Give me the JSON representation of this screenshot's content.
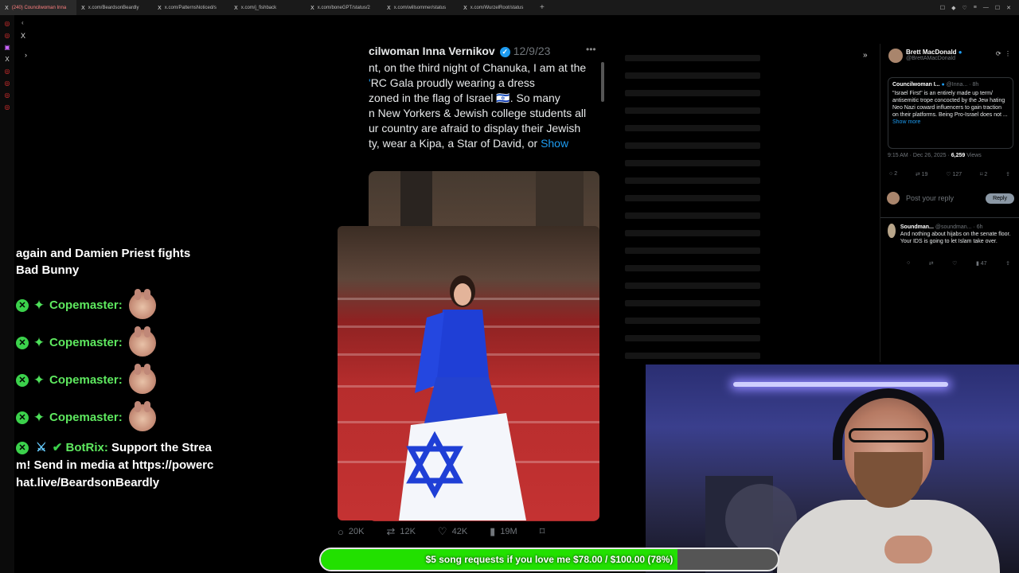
{
  "browser": {
    "tabs": [
      {
        "title": "(240) Councilwoman Inna",
        "active": true
      },
      {
        "title": "x.com/BeardsonBeardly"
      },
      {
        "title": "x.com/PatternsNoticed/s"
      },
      {
        "title": "x.com/j_fishback"
      },
      {
        "title": "x.com/boneGPT/status/2"
      },
      {
        "title": "x.com/willsommer/status"
      },
      {
        "title": "x.com/WurzelRoot/status"
      }
    ],
    "new_tab_label": "+"
  },
  "chat": {
    "lead_text": "again and Damien Priest fights Bad Bunny",
    "messages": [
      {
        "name": "Copemaster:"
      },
      {
        "name": "Copemaster:"
      },
      {
        "name": "Copemaster:"
      },
      {
        "name": "Copemaster:"
      }
    ],
    "bot": {
      "name": "BotRix:",
      "text": "Support the Stream! Send in media at https://powerchat.live/BeardsonBeardly"
    }
  },
  "tweet": {
    "author": "cilwoman Inna Vernikov",
    "date": "12/9/23",
    "body_lines": [
      "nt, on the third night of Chanuka, I am at the",
      "RC Gala proudly wearing a dress",
      "zoned in the flag of Israel 🇮🇱. So many",
      "n New Yorkers & Jewish college students all",
      "ur country are afraid to display their Jewish",
      "ty, wear a Kipa, a Star of David, or"
    ],
    "show_more": "Show",
    "actions": {
      "replies": "20K",
      "reposts": "12K",
      "likes": "42K",
      "views": "19M"
    }
  },
  "right_panel": {
    "author": "Brett MacDonald",
    "handle": "@BrettAMacDonald",
    "quote_author": "Councilwoman I...",
    "quote_handle": "@Inna... · 8h",
    "quote_text": "\"Israel First\" is an entirely made up term/ antisemitic trope concocted by the Jew hating Neo Nazi coward influencers to gain traction on their platforms. Being Pro-Israel does not ...",
    "show_more": "Show more",
    "time": "9:15 AM · Dec 26, 2025 ·",
    "views_count": "6,259",
    "views_label": "Views",
    "actions": {
      "replies": "2",
      "reposts": "19",
      "likes": "127",
      "bookmarks": "2"
    },
    "reply_placeholder": "Post your reply",
    "reply_button": "Reply",
    "reply": {
      "name": "Soundman...",
      "handle": "@soundman... · 6h",
      "text": "And nothing about hijabs on the senate floor. Your IDS is going to let Islam take over.",
      "likes": "47"
    }
  },
  "donation_goal": {
    "text": "$5 song requests if you love me $78.00 / $100.00 (78%)",
    "progress_fraction": 0.78
  },
  "colors": {
    "accent_blue": "#1d9bf0",
    "chat_green": "#5ee85f",
    "goal_green": "#22e000"
  }
}
